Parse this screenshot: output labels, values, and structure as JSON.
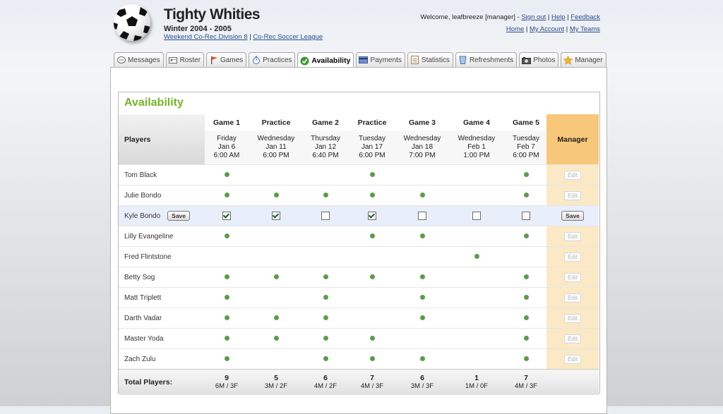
{
  "header": {
    "team_name": "Tighty Whities",
    "season": "Winter 2004 - 2005",
    "division_link": "Weekend Co-Rec Division 8",
    "separator": "|",
    "league_link": "Co-Rec Soccer League"
  },
  "user_nav": {
    "welcome": "Welcome, leafbreeze [manager]",
    "sep": "-",
    "pipe": "|",
    "sign_out": "Sign out",
    "help": "Help",
    "feedback": "Feedback",
    "home": "Home",
    "my_account": "My Account",
    "my_teams": "My Teams"
  },
  "tabs": [
    {
      "label": "Messages",
      "icon": "messages-icon"
    },
    {
      "label": "Roster",
      "icon": "roster-icon"
    },
    {
      "label": "Games",
      "icon": "games-flag-icon"
    },
    {
      "label": "Practices",
      "icon": "practices-stopwatch-icon"
    },
    {
      "label": "Availability",
      "icon": "availability-check-icon",
      "active": true
    },
    {
      "label": "Payments",
      "icon": "payments-card-icon"
    },
    {
      "label": "Statistics",
      "icon": "statistics-icon"
    },
    {
      "label": "Refreshments",
      "icon": "refreshments-cup-icon"
    },
    {
      "label": "Photos",
      "icon": "photos-camera-icon"
    },
    {
      "label": "Manager",
      "icon": "manager-star-icon"
    }
  ],
  "availability": {
    "title": "Availability",
    "players_header": "Players",
    "manager_header": "Manager",
    "events": [
      {
        "name": "Game 1",
        "day": "Friday",
        "date": "Jan 6",
        "time": "6:00 AM"
      },
      {
        "name": "Practice",
        "day": "Wednesday",
        "date": "Jan 11",
        "time": "6:00 PM"
      },
      {
        "name": "Game 2",
        "day": "Thursday",
        "date": "Jan 12",
        "time": "6:40 PM"
      },
      {
        "name": "Practice",
        "day": "Tuesday",
        "date": "Jan 17",
        "time": "6:00 PM"
      },
      {
        "name": "Game 3",
        "day": "Wednesday",
        "date": "Jan 18",
        "time": "7:00 PM"
      },
      {
        "name": "Game 4",
        "day": "Wednesday",
        "date": "Feb 1",
        "time": "1:00 PM"
      },
      {
        "name": "Game 5",
        "day": "Tuesday",
        "date": "Feb 7",
        "time": "6:00 PM"
      }
    ],
    "edit_label": "Edit",
    "save_label": "Save",
    "players": [
      {
        "name": "Tom Black",
        "avail": [
          1,
          0,
          0,
          1,
          0,
          0,
          1
        ]
      },
      {
        "name": "Julie Bondo",
        "avail": [
          1,
          1,
          1,
          1,
          1,
          0,
          1
        ]
      },
      {
        "name": "Kyle Bondo",
        "editing": true,
        "avail": [
          1,
          1,
          0,
          1,
          0,
          0,
          0
        ]
      },
      {
        "name": "Lilly Evangeline",
        "avail": [
          1,
          0,
          0,
          1,
          1,
          0,
          1
        ]
      },
      {
        "name": "Fred Flintstone",
        "avail": [
          0,
          0,
          0,
          0,
          0,
          1,
          0
        ]
      },
      {
        "name": "Betty Sog",
        "avail": [
          1,
          1,
          1,
          1,
          1,
          0,
          1
        ]
      },
      {
        "name": "Matt Triplett",
        "avail": [
          1,
          0,
          1,
          0,
          1,
          0,
          1
        ]
      },
      {
        "name": "Darth Vadar",
        "avail": [
          1,
          1,
          1,
          0,
          1,
          0,
          1
        ]
      },
      {
        "name": "Master Yoda",
        "avail": [
          1,
          1,
          1,
          1,
          0,
          0,
          1
        ]
      },
      {
        "name": "Zach Zulu",
        "avail": [
          1,
          0,
          1,
          1,
          1,
          0,
          1
        ]
      }
    ],
    "totals_label": "Total Players:",
    "totals": [
      {
        "count": "9",
        "split": "6M / 3F"
      },
      {
        "count": "5",
        "split": "3M / 2F"
      },
      {
        "count": "6",
        "split": "4M / 2F"
      },
      {
        "count": "7",
        "split": "4M / 3F"
      },
      {
        "count": "6",
        "split": "3M / 3F"
      },
      {
        "count": "1",
        "split": "1M / 0F"
      },
      {
        "count": "7",
        "split": "4M / 3F"
      }
    ]
  }
}
